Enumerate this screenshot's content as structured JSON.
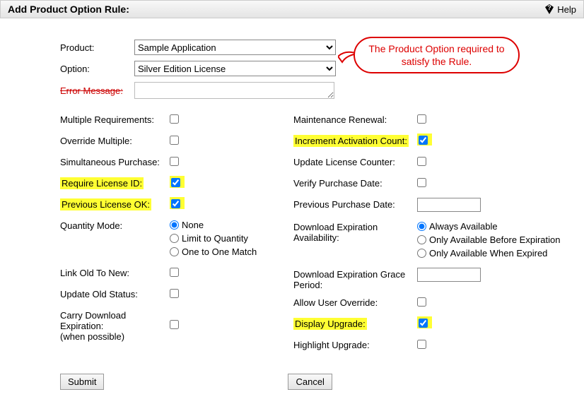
{
  "header": {
    "title": "Add Product Option Rule:",
    "help": "Help"
  },
  "callout": "The Product Option required to satisfy the Rule.",
  "top": {
    "product_label": "Product:",
    "product_value": "Sample Application",
    "option_label": "Option:",
    "option_value": "Silver Edition License",
    "error_label": "Error Message:"
  },
  "left": {
    "multiple_req": "Multiple Requirements:",
    "override_mult": "Override Multiple:",
    "simultaneous": "Simultaneous Purchase:",
    "require_license": "Require License ID:",
    "prev_license_ok": "Previous License OK:",
    "qty_mode": "Quantity Mode:",
    "qty_none": "None",
    "qty_limit": "Limit to Quantity",
    "qty_one": "One to One Match",
    "link_old": "Link Old To New:",
    "update_old": "Update Old Status:",
    "carry_dl_1": "Carry Download",
    "carry_dl_2": "Expiration:",
    "carry_dl_3": "(when possible)"
  },
  "right": {
    "maint_renewal": "Maintenance Renewal:",
    "incr_activation": "Increment Activation Count:",
    "update_license": "Update License Counter:",
    "verify_purchase": "Verify Purchase Date:",
    "prev_purchase": "Previous Purchase Date:",
    "dl_exp_avail_1": "Download Expiration",
    "dl_exp_avail_2": "Availability:",
    "avail_always": "Always Available",
    "avail_before": "Only Available Before Expiration",
    "avail_expired": "Only Available When Expired",
    "dl_grace_1": "Download Expiration Grace",
    "dl_grace_2": "Period:",
    "allow_override": "Allow User Override:",
    "display_upgrade": "Display Upgrade:",
    "highlight_upgrade": "Highlight Upgrade:"
  },
  "buttons": {
    "submit": "Submit",
    "cancel": "Cancel"
  }
}
